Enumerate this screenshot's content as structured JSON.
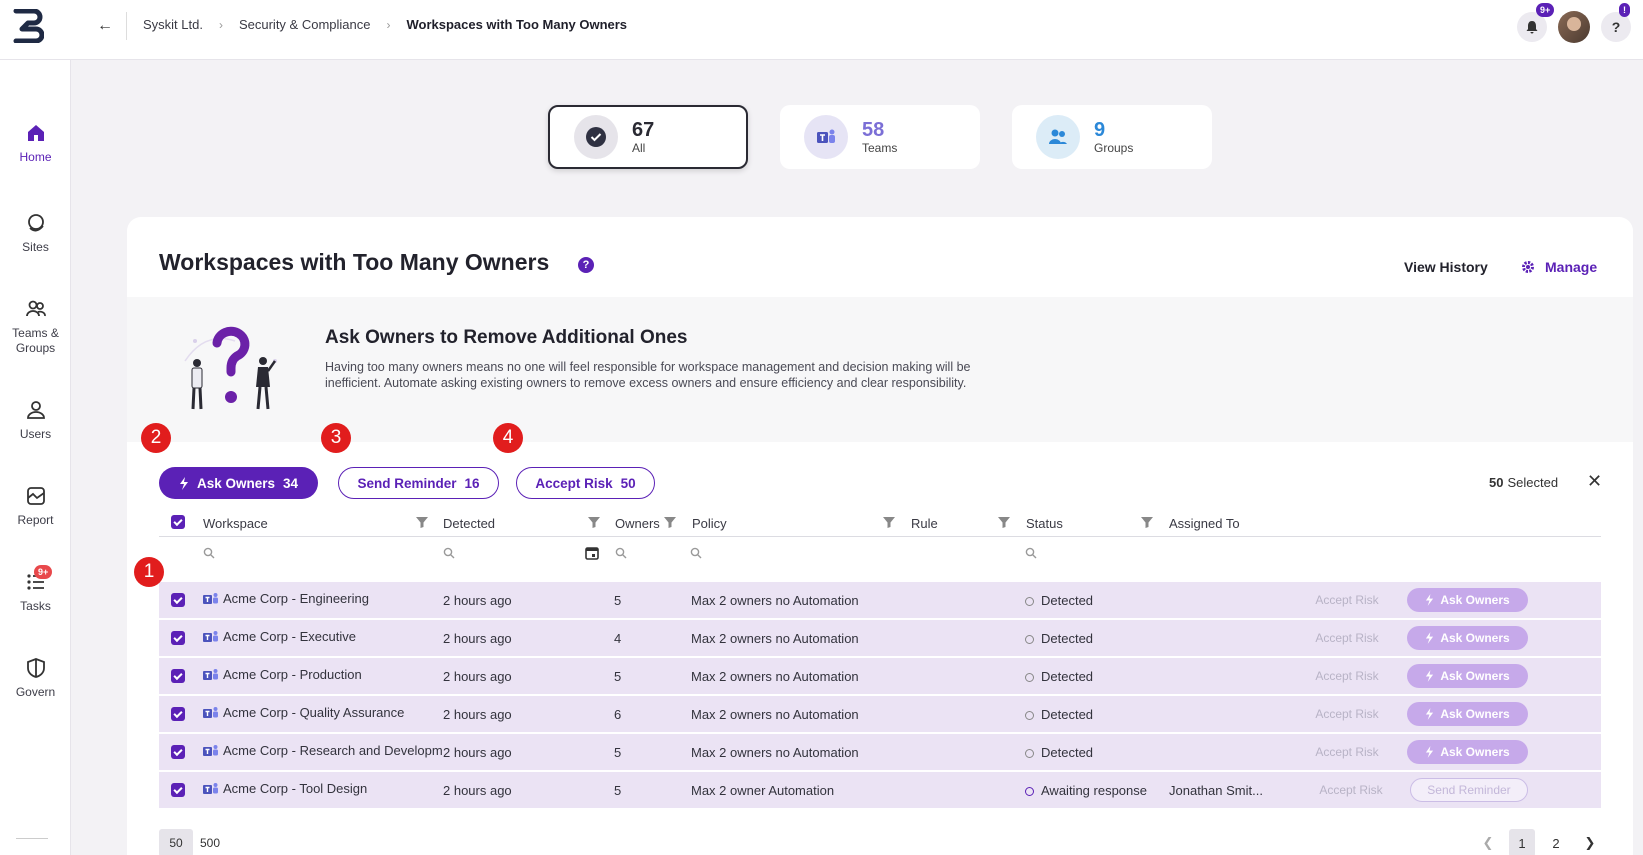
{
  "header": {
    "breadcrumbs": [
      "Syskit Ltd.",
      "Security & Compliance",
      "Workspaces with Too Many Owners"
    ],
    "notification_badge": "9+",
    "help_badge": "!",
    "help_label": "?"
  },
  "sidebar": {
    "items": [
      {
        "label": "Home",
        "icon": "home-icon",
        "active": true
      },
      {
        "label": "Sites",
        "icon": "sites-icon"
      },
      {
        "label": "Teams &\nGroups",
        "icon": "teams-groups-icon"
      },
      {
        "label": "Users",
        "icon": "users-icon"
      },
      {
        "label": "Report",
        "icon": "report-icon"
      },
      {
        "label": "Tasks",
        "icon": "tasks-icon",
        "badge": "9+"
      },
      {
        "label": "Govern",
        "icon": "govern-icon"
      }
    ]
  },
  "summary": [
    {
      "count": "67",
      "label": "All",
      "selected": true
    },
    {
      "count": "58",
      "label": "Teams"
    },
    {
      "count": "9",
      "label": "Groups"
    }
  ],
  "panel": {
    "title": "Workspaces with Too Many Owners",
    "help": "?",
    "view_history": "View History",
    "manage": "Manage"
  },
  "info": {
    "title": "Ask Owners to Remove Additional Ones",
    "description": "Having too many owners means no one will feel responsible for workspace management and decision making will be inefficient. Automate asking existing owners to remove excess owners and ensure efficiency and clear responsibility."
  },
  "actions": {
    "ask_owners": {
      "label": "Ask Owners",
      "count": "34"
    },
    "send_reminder": {
      "label": "Send Reminder",
      "count": "16"
    },
    "accept_risk": {
      "label": "Accept Risk",
      "count": "50"
    },
    "selected_count": "50",
    "selected_label": "Selected"
  },
  "markers": [
    "1",
    "2",
    "3",
    "4"
  ],
  "table": {
    "columns": [
      "Workspace",
      "Detected",
      "Owners",
      "Policy",
      "Rule",
      "Status",
      "Assigned To"
    ],
    "rows": [
      {
        "workspace": "Acme Corp - Engineering",
        "detected": "2 hours ago",
        "owners": "5",
        "policy": "Max 2 owners no Automation",
        "status": "Detected",
        "assigned": "",
        "accept": "Accept Risk",
        "action": "Ask Owners"
      },
      {
        "workspace": "Acme Corp - Executive",
        "detected": "2 hours ago",
        "owners": "4",
        "policy": "Max 2 owners no Automation",
        "status": "Detected",
        "assigned": "",
        "accept": "Accept Risk",
        "action": "Ask Owners"
      },
      {
        "workspace": "Acme Corp - Production",
        "detected": "2 hours ago",
        "owners": "5",
        "policy": "Max 2 owners no Automation",
        "status": "Detected",
        "assigned": "",
        "accept": "Accept Risk",
        "action": "Ask Owners"
      },
      {
        "workspace": "Acme Corp - Quality Assurance",
        "detected": "2 hours ago",
        "owners": "6",
        "policy": "Max 2 owners no Automation",
        "status": "Detected",
        "assigned": "",
        "accept": "Accept Risk",
        "action": "Ask Owners"
      },
      {
        "workspace": "Acme Corp - Research and Development",
        "detected": "2 hours ago",
        "owners": "5",
        "policy": "Max 2 owners no Automation",
        "status": "Detected",
        "assigned": "",
        "accept": "Accept Risk",
        "action": "Ask Owners"
      },
      {
        "workspace": "Acme Corp - Tool Design",
        "detected": "2 hours ago",
        "owners": "5",
        "policy": "Max 2 owner Automation",
        "status": "Awaiting response",
        "assigned": "Jonathan Smit...",
        "accept": "Accept Risk",
        "action": "Send Reminder"
      }
    ]
  },
  "pagination": {
    "page_sizes": [
      "50",
      "500"
    ],
    "active_size": "50",
    "pages": [
      "1",
      "2"
    ],
    "active_page": "1"
  },
  "colors": {
    "accent": "#5b21b6",
    "row_selected": "#ebe3f4",
    "marker": "#e11d1d"
  }
}
